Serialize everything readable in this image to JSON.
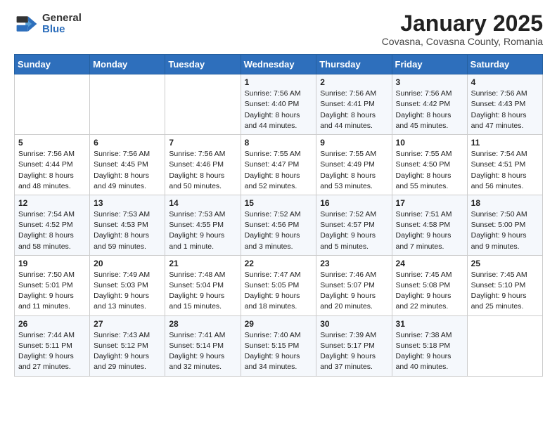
{
  "header": {
    "logo_general": "General",
    "logo_blue": "Blue",
    "month_title": "January 2025",
    "subtitle": "Covasna, Covasna County, Romania"
  },
  "weekdays": [
    "Sunday",
    "Monday",
    "Tuesday",
    "Wednesday",
    "Thursday",
    "Friday",
    "Saturday"
  ],
  "weeks": [
    [
      {
        "day": "",
        "sunrise": "",
        "sunset": "",
        "daylight": ""
      },
      {
        "day": "",
        "sunrise": "",
        "sunset": "",
        "daylight": ""
      },
      {
        "day": "",
        "sunrise": "",
        "sunset": "",
        "daylight": ""
      },
      {
        "day": "1",
        "sunrise": "Sunrise: 7:56 AM",
        "sunset": "Sunset: 4:40 PM",
        "daylight": "Daylight: 8 hours and 44 minutes."
      },
      {
        "day": "2",
        "sunrise": "Sunrise: 7:56 AM",
        "sunset": "Sunset: 4:41 PM",
        "daylight": "Daylight: 8 hours and 44 minutes."
      },
      {
        "day": "3",
        "sunrise": "Sunrise: 7:56 AM",
        "sunset": "Sunset: 4:42 PM",
        "daylight": "Daylight: 8 hours and 45 minutes."
      },
      {
        "day": "4",
        "sunrise": "Sunrise: 7:56 AM",
        "sunset": "Sunset: 4:43 PM",
        "daylight": "Daylight: 8 hours and 47 minutes."
      }
    ],
    [
      {
        "day": "5",
        "sunrise": "Sunrise: 7:56 AM",
        "sunset": "Sunset: 4:44 PM",
        "daylight": "Daylight: 8 hours and 48 minutes."
      },
      {
        "day": "6",
        "sunrise": "Sunrise: 7:56 AM",
        "sunset": "Sunset: 4:45 PM",
        "daylight": "Daylight: 8 hours and 49 minutes."
      },
      {
        "day": "7",
        "sunrise": "Sunrise: 7:56 AM",
        "sunset": "Sunset: 4:46 PM",
        "daylight": "Daylight: 8 hours and 50 minutes."
      },
      {
        "day": "8",
        "sunrise": "Sunrise: 7:55 AM",
        "sunset": "Sunset: 4:47 PM",
        "daylight": "Daylight: 8 hours and 52 minutes."
      },
      {
        "day": "9",
        "sunrise": "Sunrise: 7:55 AM",
        "sunset": "Sunset: 4:49 PM",
        "daylight": "Daylight: 8 hours and 53 minutes."
      },
      {
        "day": "10",
        "sunrise": "Sunrise: 7:55 AM",
        "sunset": "Sunset: 4:50 PM",
        "daylight": "Daylight: 8 hours and 55 minutes."
      },
      {
        "day": "11",
        "sunrise": "Sunrise: 7:54 AM",
        "sunset": "Sunset: 4:51 PM",
        "daylight": "Daylight: 8 hours and 56 minutes."
      }
    ],
    [
      {
        "day": "12",
        "sunrise": "Sunrise: 7:54 AM",
        "sunset": "Sunset: 4:52 PM",
        "daylight": "Daylight: 8 hours and 58 minutes."
      },
      {
        "day": "13",
        "sunrise": "Sunrise: 7:53 AM",
        "sunset": "Sunset: 4:53 PM",
        "daylight": "Daylight: 8 hours and 59 minutes."
      },
      {
        "day": "14",
        "sunrise": "Sunrise: 7:53 AM",
        "sunset": "Sunset: 4:55 PM",
        "daylight": "Daylight: 9 hours and 1 minute."
      },
      {
        "day": "15",
        "sunrise": "Sunrise: 7:52 AM",
        "sunset": "Sunset: 4:56 PM",
        "daylight": "Daylight: 9 hours and 3 minutes."
      },
      {
        "day": "16",
        "sunrise": "Sunrise: 7:52 AM",
        "sunset": "Sunset: 4:57 PM",
        "daylight": "Daylight: 9 hours and 5 minutes."
      },
      {
        "day": "17",
        "sunrise": "Sunrise: 7:51 AM",
        "sunset": "Sunset: 4:58 PM",
        "daylight": "Daylight: 9 hours and 7 minutes."
      },
      {
        "day": "18",
        "sunrise": "Sunrise: 7:50 AM",
        "sunset": "Sunset: 5:00 PM",
        "daylight": "Daylight: 9 hours and 9 minutes."
      }
    ],
    [
      {
        "day": "19",
        "sunrise": "Sunrise: 7:50 AM",
        "sunset": "Sunset: 5:01 PM",
        "daylight": "Daylight: 9 hours and 11 minutes."
      },
      {
        "day": "20",
        "sunrise": "Sunrise: 7:49 AM",
        "sunset": "Sunset: 5:03 PM",
        "daylight": "Daylight: 9 hours and 13 minutes."
      },
      {
        "day": "21",
        "sunrise": "Sunrise: 7:48 AM",
        "sunset": "Sunset: 5:04 PM",
        "daylight": "Daylight: 9 hours and 15 minutes."
      },
      {
        "day": "22",
        "sunrise": "Sunrise: 7:47 AM",
        "sunset": "Sunset: 5:05 PM",
        "daylight": "Daylight: 9 hours and 18 minutes."
      },
      {
        "day": "23",
        "sunrise": "Sunrise: 7:46 AM",
        "sunset": "Sunset: 5:07 PM",
        "daylight": "Daylight: 9 hours and 20 minutes."
      },
      {
        "day": "24",
        "sunrise": "Sunrise: 7:45 AM",
        "sunset": "Sunset: 5:08 PM",
        "daylight": "Daylight: 9 hours and 22 minutes."
      },
      {
        "day": "25",
        "sunrise": "Sunrise: 7:45 AM",
        "sunset": "Sunset: 5:10 PM",
        "daylight": "Daylight: 9 hours and 25 minutes."
      }
    ],
    [
      {
        "day": "26",
        "sunrise": "Sunrise: 7:44 AM",
        "sunset": "Sunset: 5:11 PM",
        "daylight": "Daylight: 9 hours and 27 minutes."
      },
      {
        "day": "27",
        "sunrise": "Sunrise: 7:43 AM",
        "sunset": "Sunset: 5:12 PM",
        "daylight": "Daylight: 9 hours and 29 minutes."
      },
      {
        "day": "28",
        "sunrise": "Sunrise: 7:41 AM",
        "sunset": "Sunset: 5:14 PM",
        "daylight": "Daylight: 9 hours and 32 minutes."
      },
      {
        "day": "29",
        "sunrise": "Sunrise: 7:40 AM",
        "sunset": "Sunset: 5:15 PM",
        "daylight": "Daylight: 9 hours and 34 minutes."
      },
      {
        "day": "30",
        "sunrise": "Sunrise: 7:39 AM",
        "sunset": "Sunset: 5:17 PM",
        "daylight": "Daylight: 9 hours and 37 minutes."
      },
      {
        "day": "31",
        "sunrise": "Sunrise: 7:38 AM",
        "sunset": "Sunset: 5:18 PM",
        "daylight": "Daylight: 9 hours and 40 minutes."
      },
      {
        "day": "",
        "sunrise": "",
        "sunset": "",
        "daylight": ""
      }
    ]
  ]
}
